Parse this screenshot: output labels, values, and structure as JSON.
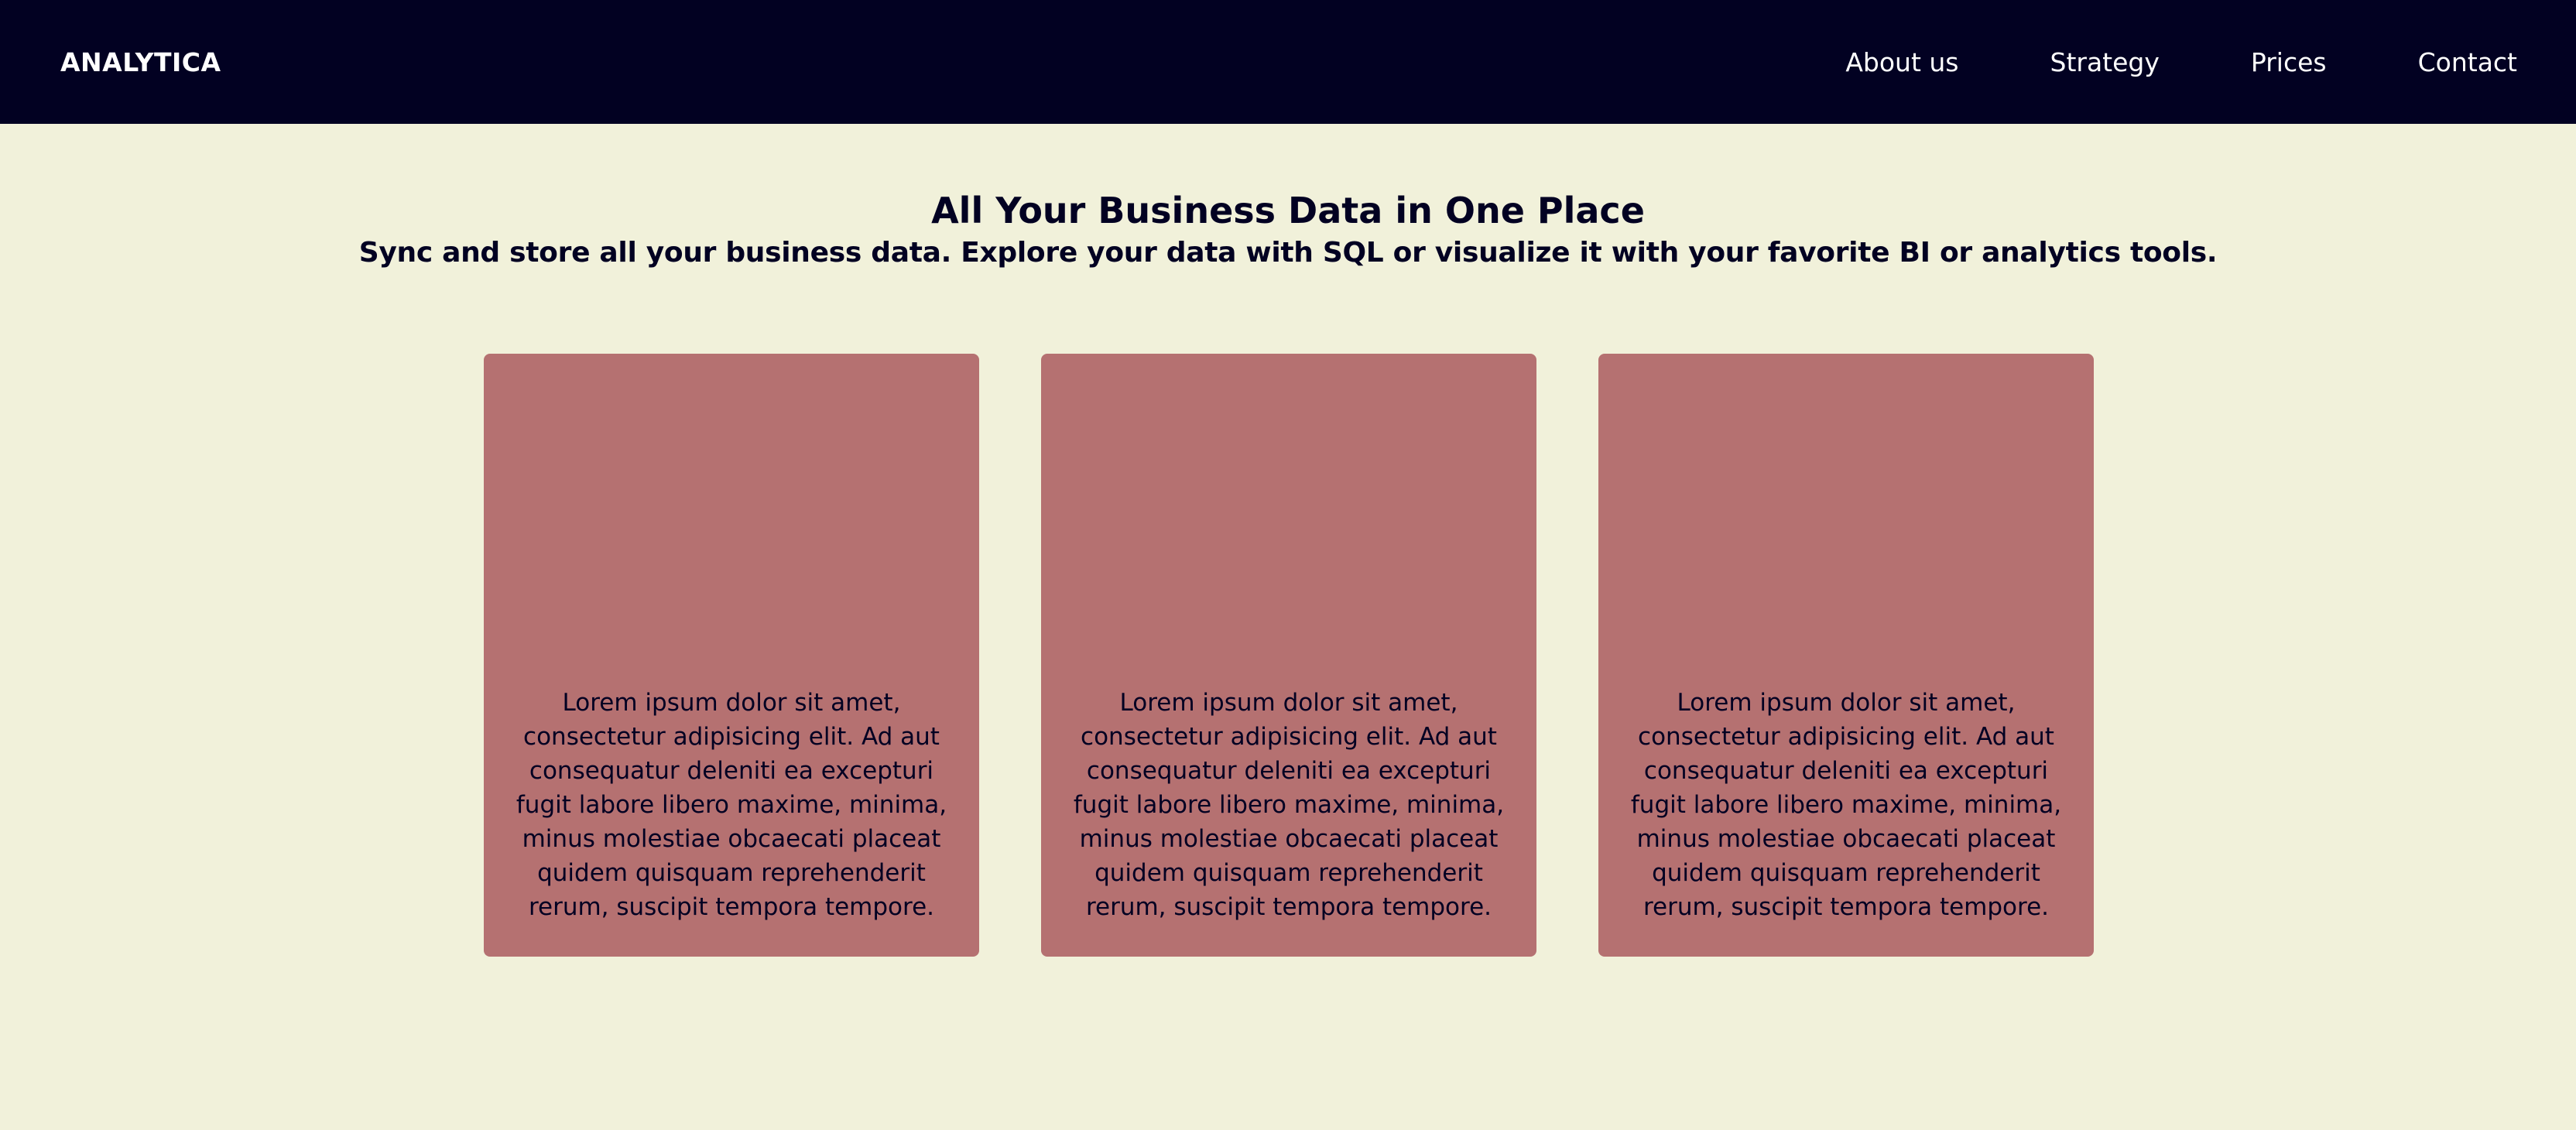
{
  "header": {
    "logo": "ANALYTICA",
    "nav": [
      {
        "label": "About us"
      },
      {
        "label": "Strategy"
      },
      {
        "label": "Prices"
      },
      {
        "label": "Contact"
      }
    ]
  },
  "hero": {
    "title": "All Your Business Data in One Place",
    "subtitle": "Sync and store all your business data. Explore your data with SQL or visualize it with your favorite BI or analytics tools."
  },
  "cards": [
    {
      "text": "Lorem ipsum dolor sit amet, consectetur adipisicing elit. Ad aut consequatur deleniti ea excepturi fugit labore libero maxime, minima, minus molestiae obcaecati placeat quidem quisquam reprehenderit rerum, suscipit tempora tempore."
    },
    {
      "text": "Lorem ipsum dolor sit amet, consectetur adipisicing elit. Ad aut consequatur deleniti ea excepturi fugit labore libero maxime, minima, minus molestiae obcaecati placeat quidem quisquam reprehenderit rerum, suscipit tempora tempore."
    },
    {
      "text": "Lorem ipsum dolor sit amet, consectetur adipisicing elit. Ad aut consequatur deleniti ea excepturi fugit labore libero maxime, minima, minus molestiae obcaecati placeat quidem quisquam reprehenderit rerum, suscipit tempora tempore."
    }
  ],
  "colors": {
    "nav_background": "#020122",
    "page_background": "#f1f1da",
    "card_background": "#b57171",
    "text": "#020122"
  }
}
